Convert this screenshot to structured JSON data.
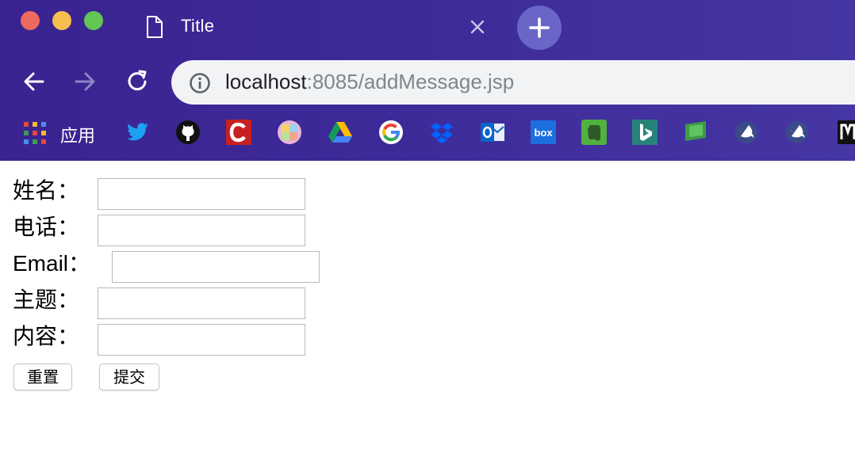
{
  "window": {
    "tab_title": "Title",
    "url_host": "localhost",
    "url_rest": ":8085/addMessage.jsp"
  },
  "bookmarks": {
    "apps_label": "应用",
    "items": [
      "twitter-icon",
      "github-icon",
      "c-icon",
      "palette-icon",
      "google-drive-icon",
      "google-icon",
      "dropbox-icon",
      "outlook-icon",
      "box-icon",
      "evernote-icon",
      "bing-icon",
      "green-monitor-icon",
      "swift-icon",
      "swift-icon",
      "m-icon"
    ]
  },
  "form": {
    "name_label": "姓名：",
    "phone_label": "电话：",
    "email_label": "Email：",
    "subject_label": "主题：",
    "content_label": "内容：",
    "name_value": "",
    "phone_value": "",
    "email_value": "",
    "subject_value": "",
    "content_value": "",
    "reset_label": "重置",
    "submit_label": "提交"
  },
  "colors": {
    "chrome_bg": "#3d2a98",
    "omnibox_bg": "#f1f3f4",
    "newtab_bg": "#6a66c8"
  }
}
